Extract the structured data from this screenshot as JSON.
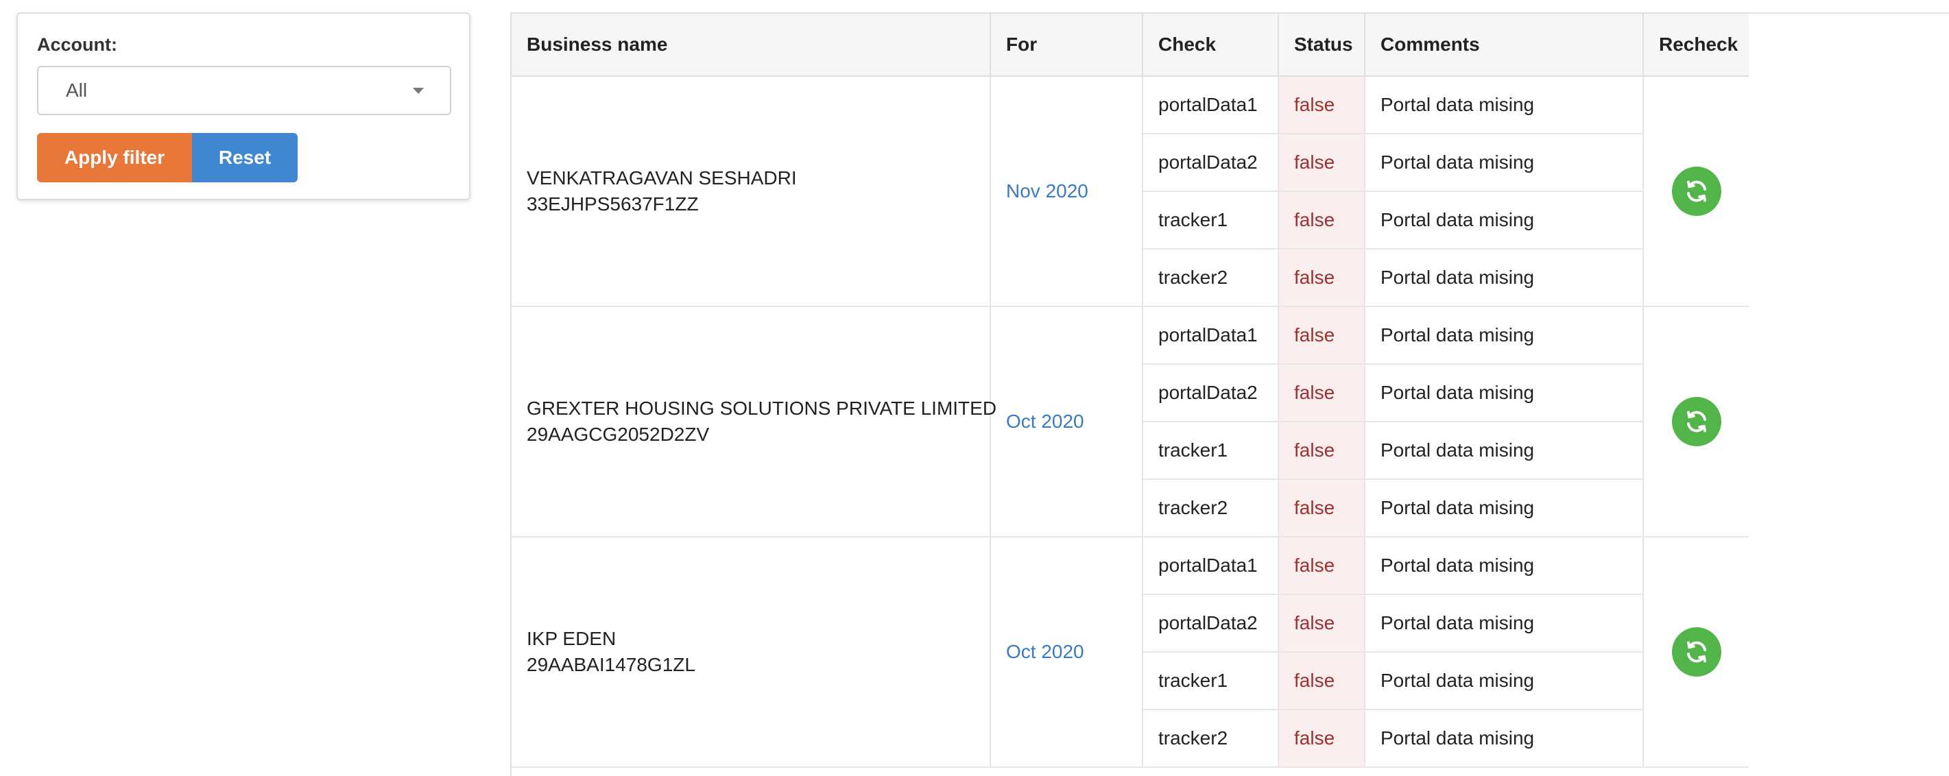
{
  "filter": {
    "account_label": "Account:",
    "account_value": "All",
    "apply_label": "Apply filter",
    "reset_label": "Reset"
  },
  "table": {
    "headers": [
      "Business name",
      "For",
      "Check",
      "Status",
      "Comments",
      "Recheck"
    ],
    "groups": [
      {
        "name": "VENKATRAGAVAN SESHADRI",
        "gstin": "33EJHPS5637F1ZZ",
        "period": "Nov 2020",
        "checks": [
          {
            "check": "portalData1",
            "status": "false",
            "comment": "Portal data mising"
          },
          {
            "check": "portalData2",
            "status": "false",
            "comment": "Portal data mising"
          },
          {
            "check": "tracker1",
            "status": "false",
            "comment": "Portal data mising"
          },
          {
            "check": "tracker2",
            "status": "false",
            "comment": "Portal data mising"
          }
        ]
      },
      {
        "name": "GREXTER HOUSING SOLUTIONS PRIVATE LIMITED",
        "gstin": "29AAGCG2052D2ZV",
        "period": "Oct 2020",
        "checks": [
          {
            "check": "portalData1",
            "status": "false",
            "comment": "Portal data mising"
          },
          {
            "check": "portalData2",
            "status": "false",
            "comment": "Portal data mising"
          },
          {
            "check": "tracker1",
            "status": "false",
            "comment": "Portal data mising"
          },
          {
            "check": "tracker2",
            "status": "false",
            "comment": "Portal data mising"
          }
        ]
      },
      {
        "name": "IKP EDEN",
        "gstin": "29AABAI1478G1ZL",
        "period": "Oct 2020",
        "checks": [
          {
            "check": "portalData1",
            "status": "false",
            "comment": "Portal data mising"
          },
          {
            "check": "portalData2",
            "status": "false",
            "comment": "Portal data mising"
          },
          {
            "check": "tracker1",
            "status": "false",
            "comment": "Portal data mising"
          },
          {
            "check": "tracker2",
            "status": "false",
            "comment": "Portal data mising"
          }
        ]
      }
    ]
  },
  "icons": {
    "select_caret": "caret-down-icon",
    "recheck": "refresh-icon"
  },
  "colors": {
    "apply_button": "#e8783a",
    "reset_button": "#3f87d1",
    "recheck_button": "#52b54a",
    "period_link": "#3a7bc0",
    "status_false_text": "#a03030",
    "status_false_bg": "#fbeeee"
  }
}
